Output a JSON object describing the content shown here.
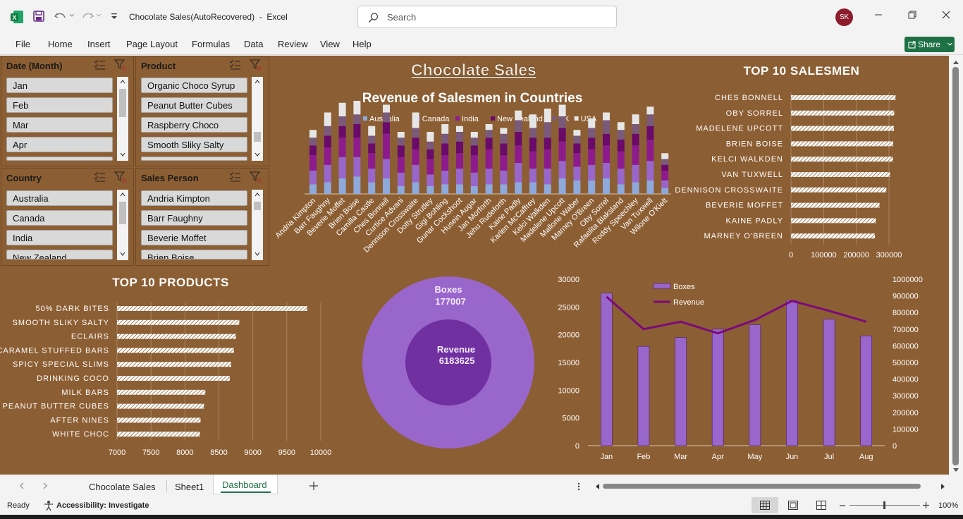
{
  "window": {
    "title": "Chocolate Sales(AutoRecovered)  -  Excel",
    "search_placeholder": "Search",
    "user_initials": "SK",
    "share_label": "Share"
  },
  "menu": [
    "File",
    "Home",
    "Insert",
    "Page Layout",
    "Formulas",
    "Data",
    "Review",
    "View",
    "Help"
  ],
  "slicers": {
    "month": {
      "title": "Date (Month)",
      "items": [
        "Jan",
        "Feb",
        "Mar",
        "Apr"
      ]
    },
    "product": {
      "title": "Product",
      "items": [
        "Organic Choco Syrup",
        "Peanut Butter Cubes",
        "Raspberry Choco",
        "Smooth Sliky Salty"
      ]
    },
    "country": {
      "title": "Country",
      "items": [
        "Australia",
        "Canada",
        "India",
        "New Zealand"
      ]
    },
    "person": {
      "title": "Sales Person",
      "items": [
        "Andria Kimpton",
        "Barr Faughny",
        "Beverie Moffet",
        "Brien Boise"
      ]
    }
  },
  "dashboard": {
    "title": "Chocolate Sales",
    "donut": {
      "boxes_label": "Boxes",
      "boxes_value": "177007",
      "revenue_label": "Revenue",
      "revenue_value": "6183625"
    }
  },
  "sheets": {
    "tabs": [
      "Chocolate Sales",
      "Sheet1",
      "Dashboard"
    ],
    "active": "Dashboard"
  },
  "status": {
    "ready": "Ready",
    "accessibility": "Accessibility: Investigate",
    "zoom": "100%"
  },
  "chart_data": [
    {
      "type": "bar",
      "stacked": true,
      "title": "Revenue of Salesmen in Countries",
      "legend_position": "top",
      "categories": [
        "Andria Kimpton",
        "Barr Faughny",
        "Beverie Moffet",
        "Brien Boise",
        "Camilla Castle",
        "Ches Bonnell",
        "Curtice Advani",
        "Dennison Crosswaite",
        "Dotty Strutley",
        "Gigi Bohling",
        "Gunar Cockshoot",
        "Husein Augar",
        "Jan Morforth",
        "Jehu Rudeforth",
        "Kaine Padly",
        "Karlen McCaffrey",
        "Kelci Walkden",
        "Madelene Upcott",
        "Mallorie Waber",
        "Marney O'Breen",
        "Oby Sorrel",
        "Rafaelita Blaksland",
        "Roddy Speechley",
        "Van Tuxwell",
        "Wilone O'Kielt"
      ],
      "series": [
        {
          "name": "Australia",
          "color": "#8ea9db",
          "values": [
            25,
            30,
            40,
            45,
            30,
            40,
            20,
            30,
            20,
            25,
            25,
            20,
            25,
            25,
            30,
            30,
            25,
            40,
            35,
            35,
            40,
            25,
            30,
            35,
            15
          ]
        },
        {
          "name": "Canada",
          "color": "#9966cc",
          "values": [
            35,
            45,
            55,
            50,
            35,
            50,
            35,
            45,
            30,
            35,
            40,
            35,
            40,
            35,
            50,
            35,
            40,
            45,
            35,
            40,
            40,
            40,
            45,
            50,
            20
          ]
        },
        {
          "name": "India",
          "color": "#8e1b8e",
          "values": [
            40,
            45,
            50,
            50,
            40,
            65,
            40,
            40,
            40,
            40,
            40,
            45,
            50,
            40,
            45,
            45,
            50,
            50,
            35,
            40,
            45,
            45,
            50,
            55,
            25
          ]
        },
        {
          "name": "New Zealand",
          "color": "#6a0a6a",
          "values": [
            25,
            30,
            30,
            35,
            25,
            30,
            30,
            30,
            25,
            30,
            30,
            25,
            30,
            30,
            35,
            35,
            30,
            35,
            25,
            30,
            30,
            30,
            30,
            35,
            15
          ]
        },
        {
          "name": "UK",
          "color": "#7a5a7a",
          "values": [
            20,
            25,
            25,
            25,
            20,
            25,
            20,
            25,
            20,
            25,
            25,
            20,
            20,
            25,
            30,
            25,
            40,
            30,
            20,
            25,
            35,
            25,
            25,
            30,
            15
          ]
        },
        {
          "name": "USA",
          "color": "#e7e6e6",
          "values": [
            20,
            35,
            35,
            35,
            25,
            20,
            15,
            40,
            25,
            25,
            15,
            15,
            15,
            15,
            25,
            35,
            35,
            30,
            15,
            25,
            20,
            20,
            25,
            20,
            15
          ]
        }
      ]
    },
    {
      "type": "bar",
      "orientation": "horizontal",
      "title": "TOP 10 SALESMEN",
      "categories": [
        "CHES BONNELL",
        "OBY SORREL",
        "MADELENE UPCOTT",
        "BRIEN BOISE",
        "KELCI WALKDEN",
        "VAN TUXWELL",
        "DENNISON CROSSWAITE",
        "BEVERIE MOFFET",
        "KAINE PADLY",
        "MARNEY O'BREEN"
      ],
      "values": [
        320000,
        316000,
        315000,
        313000,
        312000,
        303000,
        292000,
        271000,
        260000,
        257000
      ],
      "xlim": [
        0,
        300000
      ],
      "xticks": [
        "0",
        "100000",
        "200000",
        "300000"
      ]
    },
    {
      "type": "bar",
      "orientation": "horizontal",
      "title": "TOP 10 PRODUCTS",
      "categories": [
        "50% DARK BITES",
        "SMOOTH SLIKY SALTY",
        "ECLAIRS",
        "CARAMEL STUFFED BARS",
        "SPICY SPECIAL SLIMS",
        "DRINKING COCO",
        "MILK BARS",
        "PEANUT BUTTER CUBES",
        "AFTER NINES",
        "WHITE CHOC"
      ],
      "values": [
        9800,
        8800,
        8750,
        8720,
        8680,
        8660,
        8300,
        8280,
        8230,
        8220
      ],
      "xlim": [
        7000,
        10000
      ],
      "xticks": [
        "7000",
        "7500",
        "8000",
        "8500",
        "9000",
        "9500",
        "10000"
      ]
    },
    {
      "type": "bar",
      "combo": "bar+line",
      "categories": [
        "Jan",
        "Feb",
        "Mar",
        "Apr",
        "May",
        "Jun",
        "Jul",
        "Aug"
      ],
      "series": [
        {
          "name": "Boxes",
          "type": "bar",
          "color": "#9966cc",
          "axis": "left",
          "values": [
            27500,
            17900,
            19500,
            21000,
            21800,
            26200,
            22800,
            19800
          ]
        },
        {
          "name": "Revenue",
          "type": "line",
          "color": "#7b0a7b",
          "axis": "right",
          "values": [
            895000,
            700000,
            745000,
            675000,
            755000,
            870000,
            810000,
            745000
          ]
        }
      ],
      "ylim_left": [
        0,
        30000
      ],
      "ylim_right": [
        0,
        1000000
      ],
      "yticks_left": [
        "0",
        "5000",
        "10000",
        "15000",
        "20000",
        "25000",
        "30000"
      ],
      "yticks_right": [
        "0",
        "100000",
        "200000",
        "300000",
        "400000",
        "500000",
        "600000",
        "700000",
        "800000",
        "900000",
        "1000000"
      ],
      "legend_position": "top-left"
    }
  ]
}
